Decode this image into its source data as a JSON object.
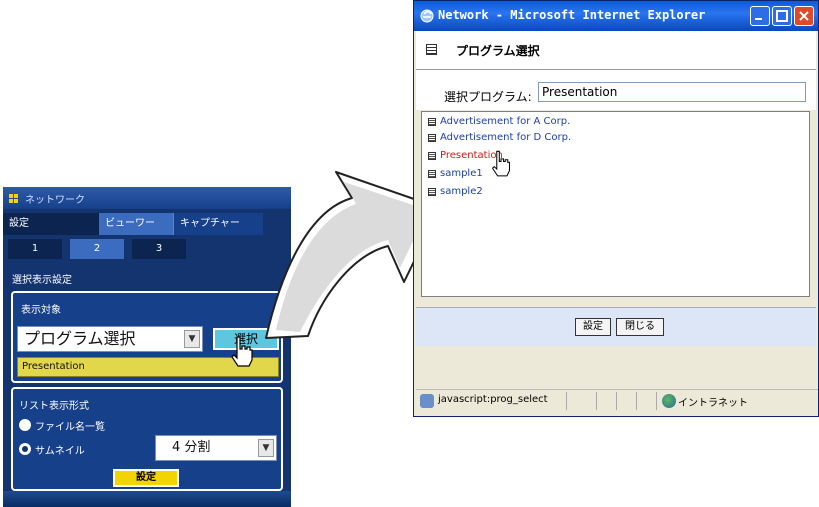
{
  "left_panel": {
    "title": "ネットワーク",
    "tabs": [
      "設定",
      "ビューワー",
      "キャプチャー"
    ],
    "subtabs": [
      "1",
      "2",
      "3"
    ],
    "section_label": "選択表示設定",
    "display_target": {
      "label": "表示対象",
      "combo_value": "プログラム選択",
      "select_button": "選択",
      "current_program": "Presentation"
    },
    "list_format": {
      "label": "リスト表示形式",
      "option_file_list": "ファイル名一覧",
      "option_thumbnail": "サムネイル",
      "thumbnail_split": "4 分割",
      "set_button": "設定"
    }
  },
  "ie_window": {
    "title": "Network - Microsoft Internet Explorer",
    "page_heading": "プログラム選択",
    "selected_program_label": "選択プログラム:",
    "selected_program_value": "Presentation",
    "programs": [
      "Advertisement for A Corp.",
      "Advertisement for D Corp.",
      "Presentation",
      "sample1",
      "sample2"
    ],
    "buttons": {
      "set": "設定",
      "close": "閉じる"
    },
    "status_text": "javascript:prog_select",
    "zone_text": "イントラネット"
  },
  "colors": {
    "panel_bg": "#13346e",
    "select_button": "#5fc6df",
    "set_button": "#f2d400",
    "highlight_bar": "#e2d64a",
    "link": "#1f3fa6",
    "selected_link": "#d01818",
    "xp_titlebar": "#0b5bd8"
  },
  "icons": [
    "pointer-hand-icon",
    "list-doc-icon",
    "ie-icon",
    "minimize-icon",
    "maximize-icon",
    "close-icon",
    "intranet-icon"
  ]
}
